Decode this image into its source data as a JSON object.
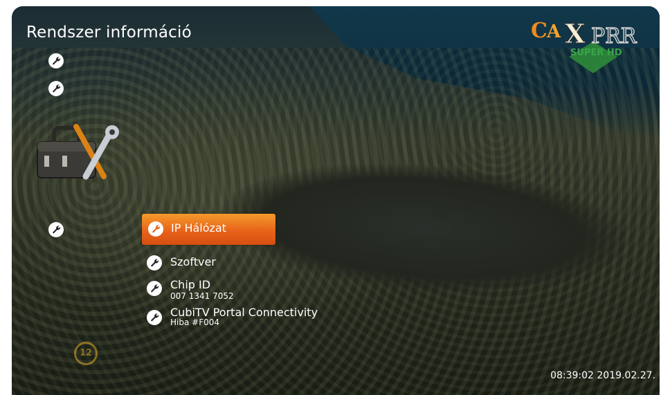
{
  "screen": {
    "title": "Rendszer információ",
    "datetime": "08:39:02 2019.02.27."
  },
  "logo": {
    "brand_text": "CATXPRR",
    "sub_text": "SUPER HD"
  },
  "age_rating": "12",
  "menu": {
    "items": [
      {
        "label": "IP Hálózat",
        "selected": true,
        "icon": "wrench-icon"
      },
      {
        "label": "Szoftver",
        "selected": false,
        "icon": "wrench-icon"
      },
      {
        "label": "Chip ID",
        "sub": "007 1341 7052",
        "selected": false,
        "icon": "wrench-icon"
      },
      {
        "label": "CubiTV Portal Connectivity",
        "sub": "Hiba #F004",
        "selected": false,
        "icon": "wrench-icon"
      }
    ]
  },
  "colors": {
    "selected_bg": "#e8631a",
    "text": "#ffffff"
  }
}
